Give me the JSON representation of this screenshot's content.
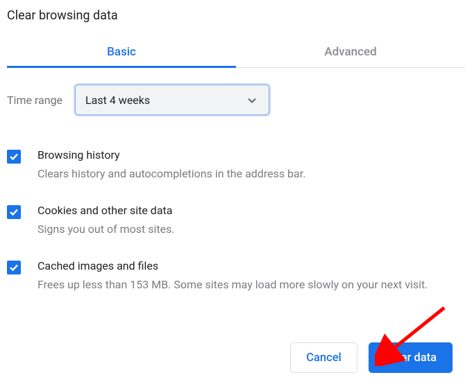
{
  "title": "Clear browsing data",
  "tabs": {
    "basic": "Basic",
    "advanced": "Advanced"
  },
  "range": {
    "label": "Time range",
    "selected": "Last 4 weeks"
  },
  "options": {
    "history": {
      "title": "Browsing history",
      "desc": "Clears history and autocompletions in the address bar."
    },
    "cookies": {
      "title": "Cookies and other site data",
      "desc": "Signs you out of most sites."
    },
    "cache": {
      "title": "Cached images and files",
      "desc": "Frees up less than 153 MB. Some sites may load more slowly on your next visit."
    }
  },
  "buttons": {
    "cancel": "Cancel",
    "clear": "Clear data"
  }
}
